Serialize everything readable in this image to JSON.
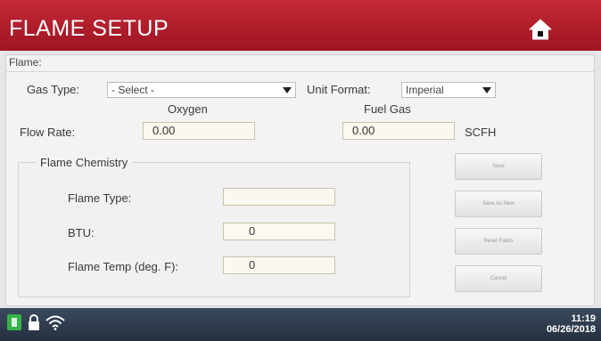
{
  "title_bar": {
    "title": "FLAME SETUP",
    "home_icon": "home-icon"
  },
  "flame_panel": {
    "label": "Flame:",
    "gas_type": {
      "label": "Gas Type:",
      "selected": "- Select -"
    },
    "unit_format": {
      "label": "Unit Format:",
      "selected": "Imperial"
    },
    "columns": {
      "oxygen": "Oxygen",
      "fuel_gas": "Fuel Gas"
    },
    "flow_rate": {
      "label": "Flow Rate:",
      "oxygen_value": "0.00",
      "fuel_gas_value": "0.00",
      "unit": "SCFH"
    }
  },
  "flame_chemistry": {
    "legend": "Flame Chemistry",
    "flame_type": {
      "label": "Flame Type:",
      "value": ""
    },
    "btu": {
      "label": "BTU:",
      "value": "0"
    },
    "flame_temp": {
      "label": "Flame Temp (deg. F):",
      "value": "0"
    }
  },
  "buttons": {
    "save": "Save",
    "save_as_new": "Save As New",
    "reset_fields": "Reset Fields",
    "cancel": "Cancel"
  },
  "status_bar": {
    "time": "11:19",
    "date": "06/26/2018",
    "icons": [
      "battery-icon",
      "lock-icon",
      "wifi-icon"
    ]
  },
  "colors": {
    "title_bar": "#b01d2b",
    "status_bar": "#2e3a4c",
    "battery": "#37b34a"
  }
}
